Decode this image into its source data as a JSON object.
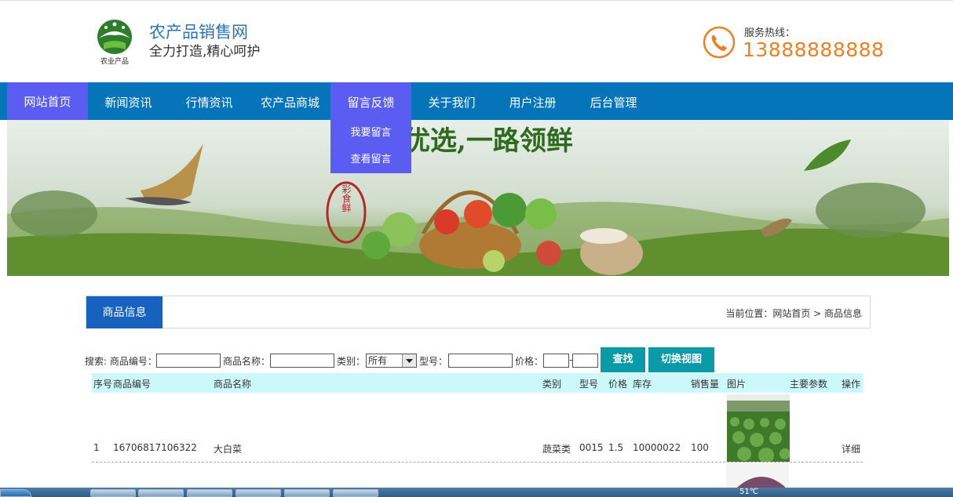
{
  "header": {
    "logo_text": "农业产品",
    "site_title": "农产品销售网",
    "slogan": "全力打造,精心呵护",
    "hotline_label": "服务热线：",
    "hotline_number": "13888888888"
  },
  "nav": {
    "items": [
      {
        "label": "网站首页"
      },
      {
        "label": "新闻资讯"
      },
      {
        "label": "行情资讯"
      },
      {
        "label": "农产品商城"
      },
      {
        "label": "留言反馈"
      },
      {
        "label": "关于我们"
      },
      {
        "label": "用户注册"
      },
      {
        "label": "后台管理"
      }
    ],
    "dropdown": [
      {
        "label": "我要留言"
      },
      {
        "label": "查看留言"
      }
    ]
  },
  "banner": {
    "headline": "优选,一路领鲜",
    "seal": "彩食鲜"
  },
  "section": {
    "tab": "商品信息",
    "breadcrumb": "当前位置：网站首页 > 商品信息"
  },
  "search": {
    "prefix": "搜索: 商品编号：",
    "name_label": "商品名称：",
    "category_label": "类别：",
    "category_value": "所有",
    "model_label": "型号：",
    "price_label": "价格：",
    "price_sep": "-",
    "search_button": "查找",
    "switch_button": "切换视图"
  },
  "table": {
    "headers": [
      "序号",
      "商品编号",
      "商品名称",
      "类别",
      "型号",
      "价格",
      "库存",
      "销售量",
      "图片",
      "主要参数",
      "操作"
    ],
    "rows": [
      {
        "no": "1",
        "code": "16706817106322",
        "name": "大白菜",
        "category": "蔬菜类",
        "model": "0015",
        "price": "1.5",
        "stock": "10000022",
        "sales": "100",
        "params": "",
        "action": "详细"
      }
    ]
  },
  "taskbar": {
    "temperature": "51℃"
  }
}
